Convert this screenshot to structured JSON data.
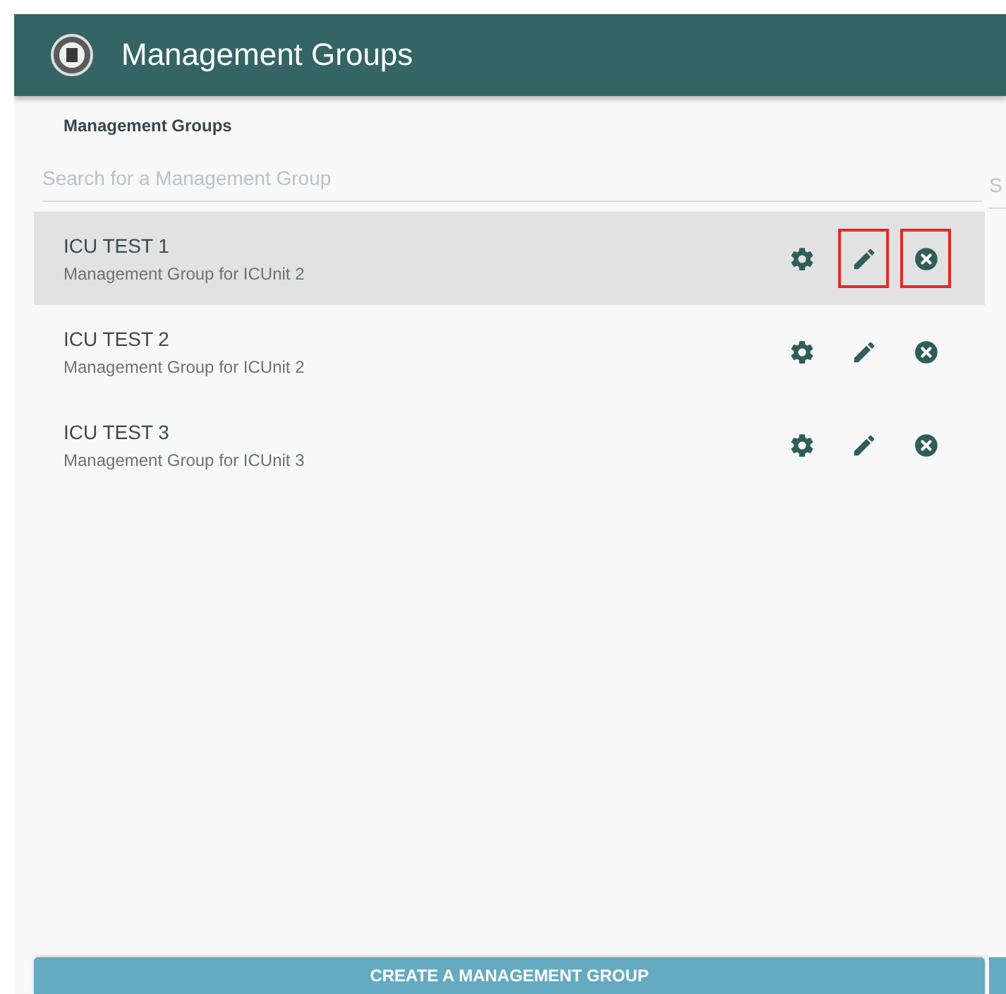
{
  "header": {
    "title": "Management Groups"
  },
  "section_label": "Management Groups",
  "search": {
    "placeholder": "Search for a Management Group"
  },
  "side_search": {
    "placeholder": "S"
  },
  "groups": [
    {
      "name": "ICU TEST 1",
      "description": "Management Group for ICUnit 2",
      "selected": true,
      "actions": [
        {
          "kind": "settings",
          "outlined": false
        },
        {
          "kind": "edit",
          "outlined": true
        },
        {
          "kind": "delete",
          "outlined": true
        }
      ]
    },
    {
      "name": "ICU TEST 2",
      "description": "Management Group for ICUnit 2",
      "selected": false,
      "actions": [
        {
          "kind": "settings",
          "outlined": false
        },
        {
          "kind": "edit",
          "outlined": false
        },
        {
          "kind": "delete",
          "outlined": false
        }
      ]
    },
    {
      "name": "ICU TEST 3",
      "description": "Management Group for ICUnit 3",
      "selected": false,
      "actions": [
        {
          "kind": "settings",
          "outlined": false
        },
        {
          "kind": "edit",
          "outlined": false
        },
        {
          "kind": "delete",
          "outlined": false
        }
      ]
    }
  ],
  "create_button": "CREATE A MANAGEMENT GROUP"
}
